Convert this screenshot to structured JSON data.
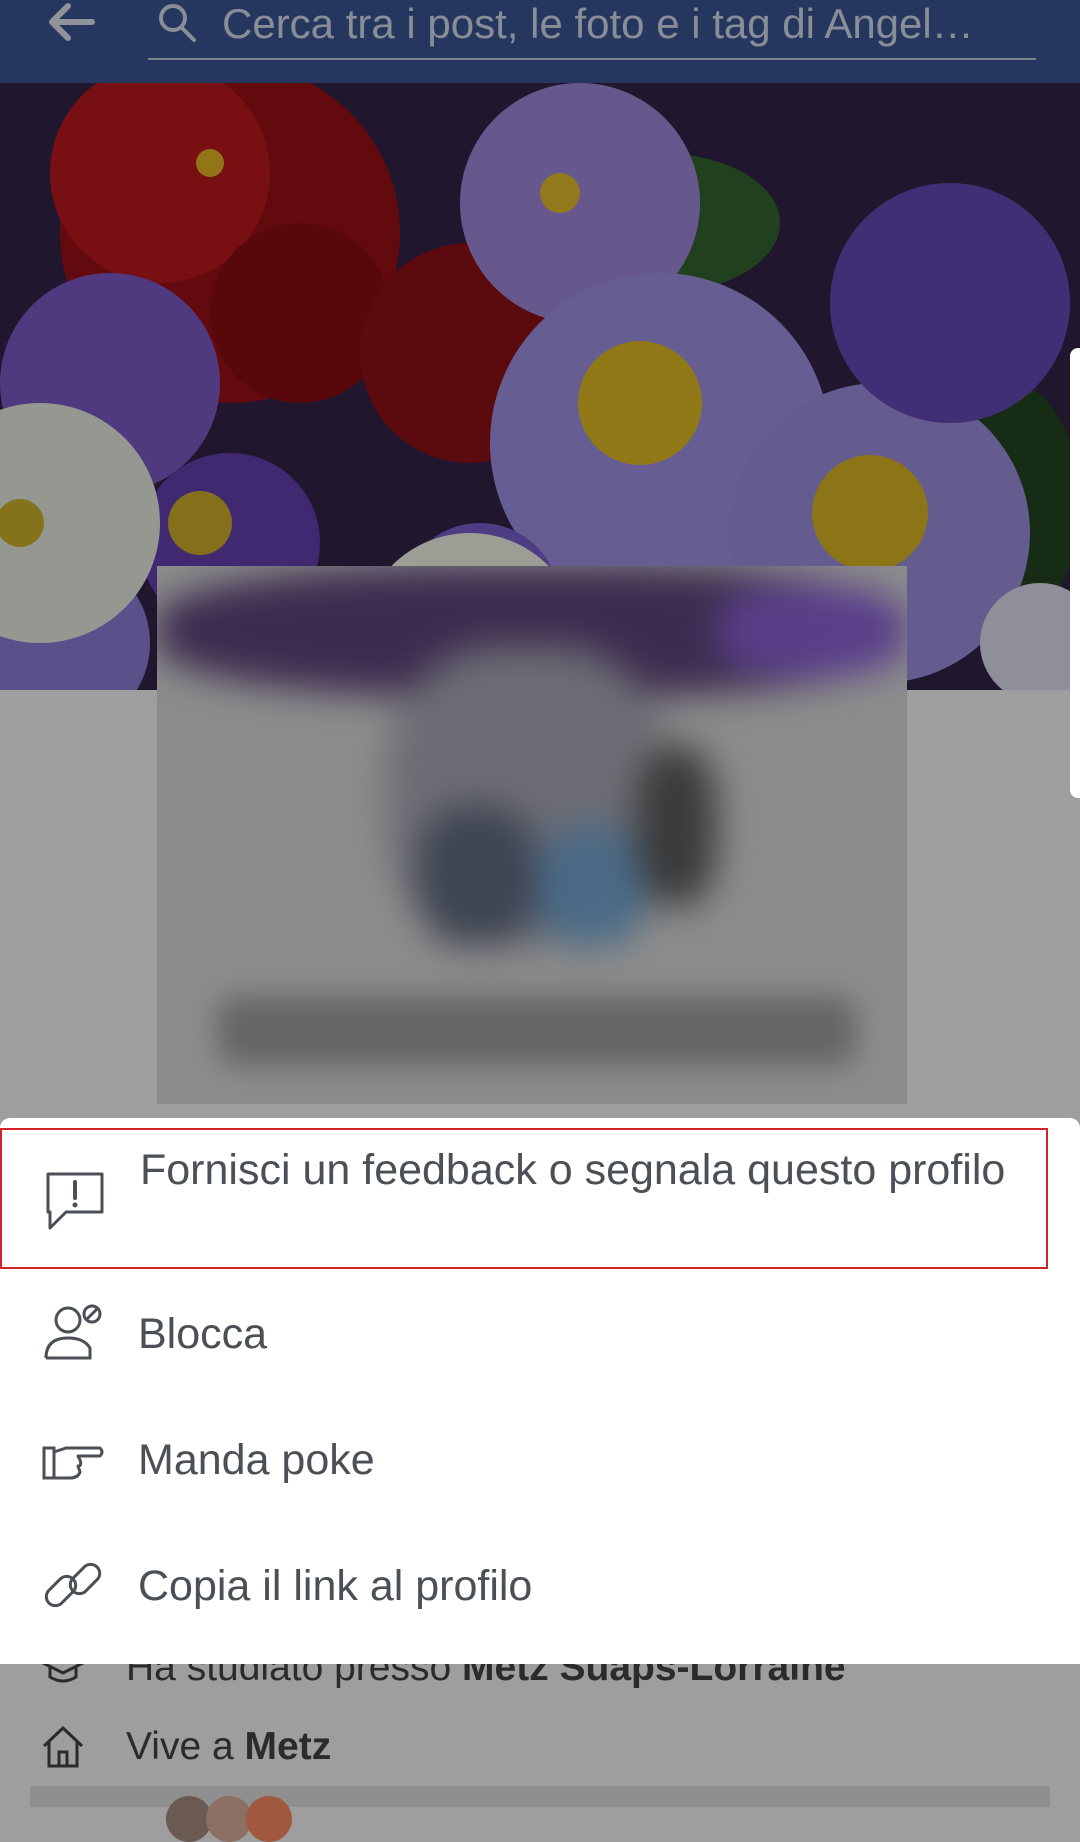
{
  "header": {
    "search_placeholder": "Cerca tra i post, le foto e i tag di Angel…",
    "back_icon": "arrow-left-icon",
    "search_icon": "search-icon",
    "background_color": "#3b5998"
  },
  "menu": {
    "items": [
      {
        "label": "Fornisci un feedback o segnala questo profilo",
        "icon": "report-icon",
        "highlighted": true
      },
      {
        "label": "Blocca",
        "icon": "block-user-icon"
      },
      {
        "label": "Manda poke",
        "icon": "poke-hand-icon"
      },
      {
        "label": "Copia il link al profilo",
        "icon": "link-icon"
      }
    ],
    "highlight_color": "#d2232a"
  },
  "profile_info": {
    "study_prefix": "Ha studiato presso ",
    "study_place": "Metz Suaps-Lorraine",
    "live_prefix": "Vive a ",
    "live_place": "Metz"
  }
}
